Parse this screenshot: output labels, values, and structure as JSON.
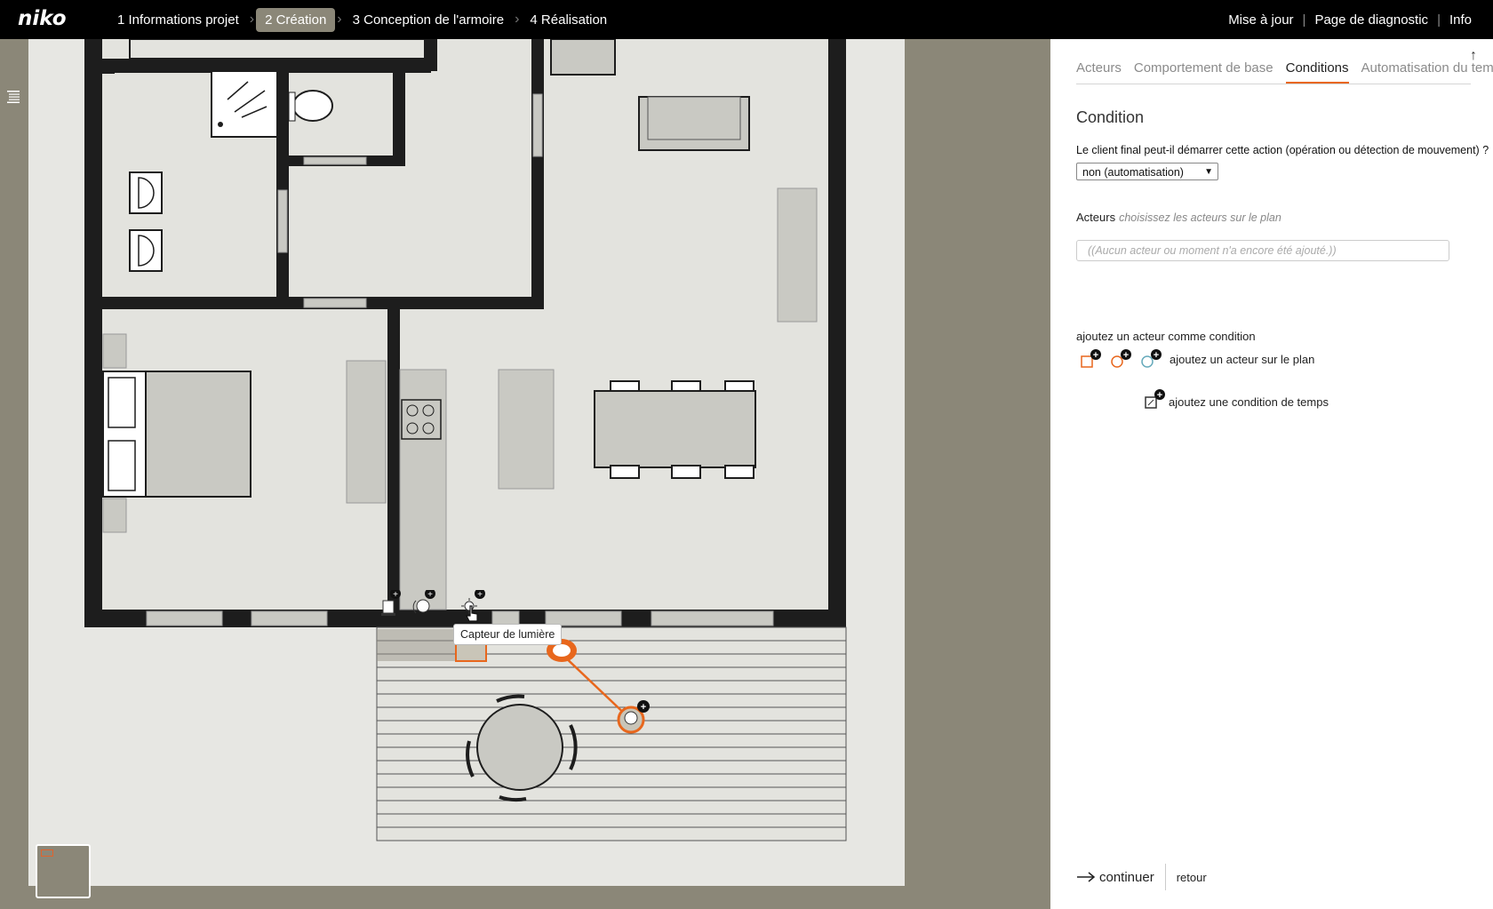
{
  "app": {
    "logo": "niko"
  },
  "steps": [
    {
      "label": "1 Informations projet",
      "active": false
    },
    {
      "label": "2 Création",
      "active": true
    },
    {
      "label": "3 Conception de l'armoire",
      "active": false
    },
    {
      "label": "4 Réalisation",
      "active": false
    }
  ],
  "toplinks": {
    "update": "Mise à jour",
    "diagnostic": "Page de diagnostic",
    "info": "Info"
  },
  "plan": {
    "tooltip": "Capteur de lumière",
    "accent_color": "#e8671d"
  },
  "panel": {
    "tabs": [
      {
        "label": "Acteurs",
        "active": false
      },
      {
        "label": "Comportement de base",
        "active": false
      },
      {
        "label": "Conditions",
        "active": true
      },
      {
        "label": "Automatisation du temps",
        "active": false
      }
    ],
    "title": "Condition",
    "question": "Le client final peut-il démarrer cette action (opération ou détection de mouvement) ?",
    "select_value": "non (automatisation)",
    "actors_label": "Acteurs",
    "actors_hint": "choisissez les acteurs sur le plan",
    "actors_empty": "((Aucun acteur ou moment n'a encore été ajouté.))",
    "add_condition_title": "ajoutez un acteur comme condition",
    "add_actor_label": "ajoutez un acteur sur le plan",
    "add_time_label": "ajoutez une condition de temps",
    "continue_label": "continuer",
    "back_label": "retour"
  }
}
